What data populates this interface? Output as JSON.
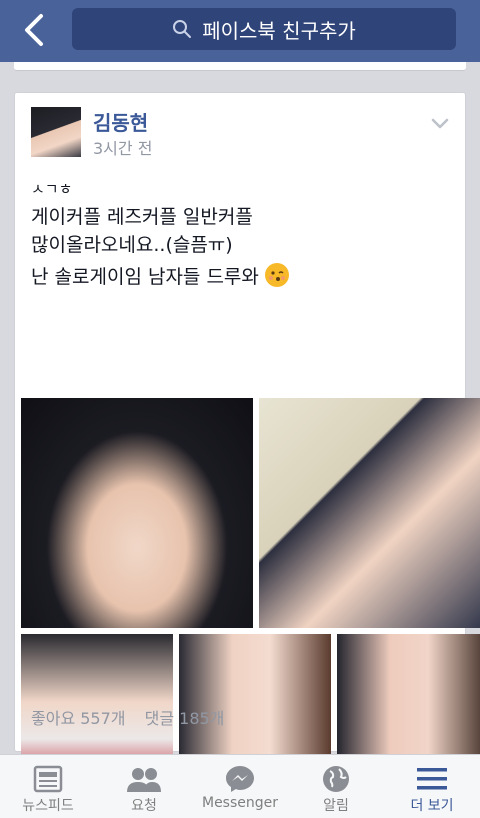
{
  "header": {
    "search_placeholder": "페이스북 친구추가"
  },
  "post": {
    "author": "김동현",
    "time": "3시간 전",
    "lines": [
      "ㅅㄱㅎ",
      "게이커플 레즈커플 일반커플",
      "많이올라오네요..(슬픔ㅠ)",
      "난 솔로게이임 남자들 드루와"
    ],
    "likes": "좋아요 557개",
    "comments": "댓글 185개"
  },
  "tabs": [
    {
      "label": "뉴스피드",
      "icon": "news-feed-icon"
    },
    {
      "label": "요청",
      "icon": "friend-requests-icon"
    },
    {
      "label": "Messenger",
      "icon": "messenger-icon"
    },
    {
      "label": "알림",
      "icon": "globe-icon"
    },
    {
      "label": "더 보기",
      "icon": "menu-icon"
    }
  ],
  "colors": {
    "brand": "#4a629a",
    "link": "#3b5998",
    "active_tab": "#3b5998"
  }
}
